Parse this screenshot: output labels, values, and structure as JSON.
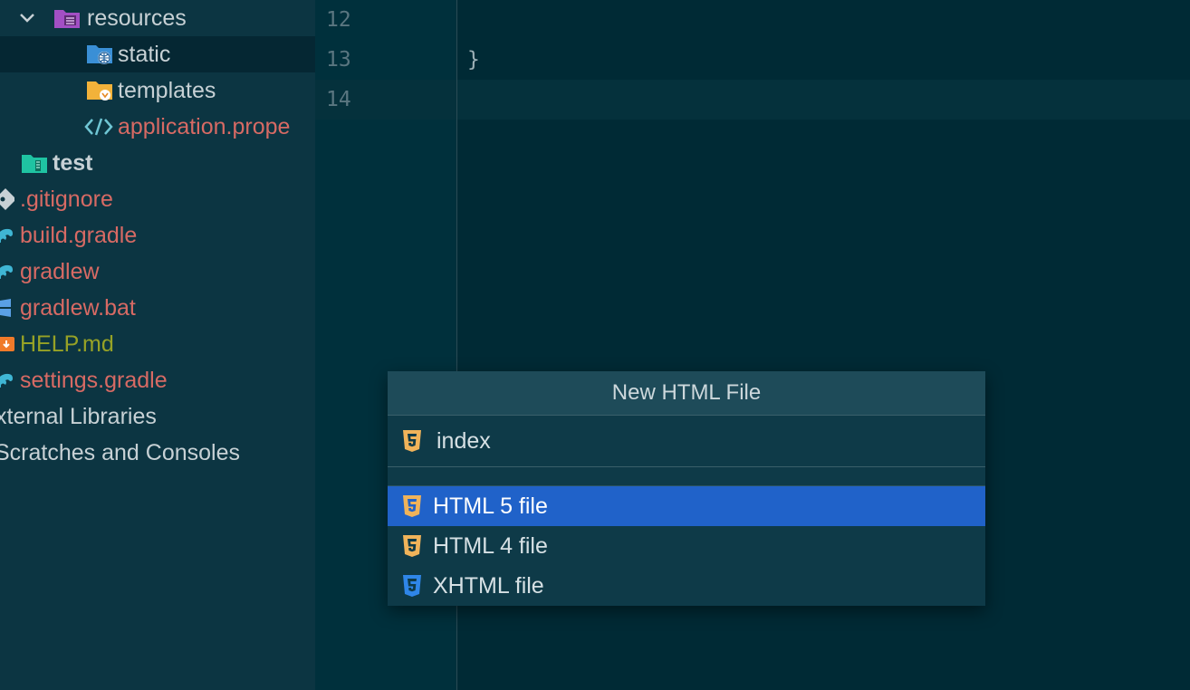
{
  "project_tree": {
    "items": [
      {
        "label": "resources",
        "kind": "folder-resources"
      },
      {
        "label": "static",
        "kind": "folder-static"
      },
      {
        "label": "templates",
        "kind": "folder-templates"
      },
      {
        "label": "application.prope",
        "kind": "properties-file"
      },
      {
        "label": "test",
        "kind": "folder-test"
      },
      {
        "label": ".gitignore",
        "kind": "gitignore-file"
      },
      {
        "label": "build.gradle",
        "kind": "gradle-file"
      },
      {
        "label": "gradlew",
        "kind": "gradle-file"
      },
      {
        "label": "gradlew.bat",
        "kind": "windows-file"
      },
      {
        "label": "HELP.md",
        "kind": "markdown-file"
      },
      {
        "label": "settings.gradle",
        "kind": "gradle-file"
      },
      {
        "label": "xternal Libraries",
        "kind": "external-libraries"
      },
      {
        "label": "Scratches and Consoles",
        "kind": "scratches"
      }
    ]
  },
  "editor": {
    "line_numbers": [
      "12",
      "13",
      "14"
    ],
    "lines": [
      "",
      "}",
      ""
    ]
  },
  "popup": {
    "title": "New HTML File",
    "input_value": "index",
    "options": [
      {
        "label": "HTML 5 file",
        "icon": "html5-icon",
        "selected": true
      },
      {
        "label": "HTML 4 file",
        "icon": "html5-icon",
        "selected": false
      },
      {
        "label": "XHTML file",
        "icon": "css-icon",
        "selected": false
      }
    ]
  },
  "colors": {
    "background": "#002a35",
    "sidebar": "#0c3542",
    "selection": "#2062c9",
    "modified_file": "#d76a64",
    "untracked_file": "#97a226"
  }
}
